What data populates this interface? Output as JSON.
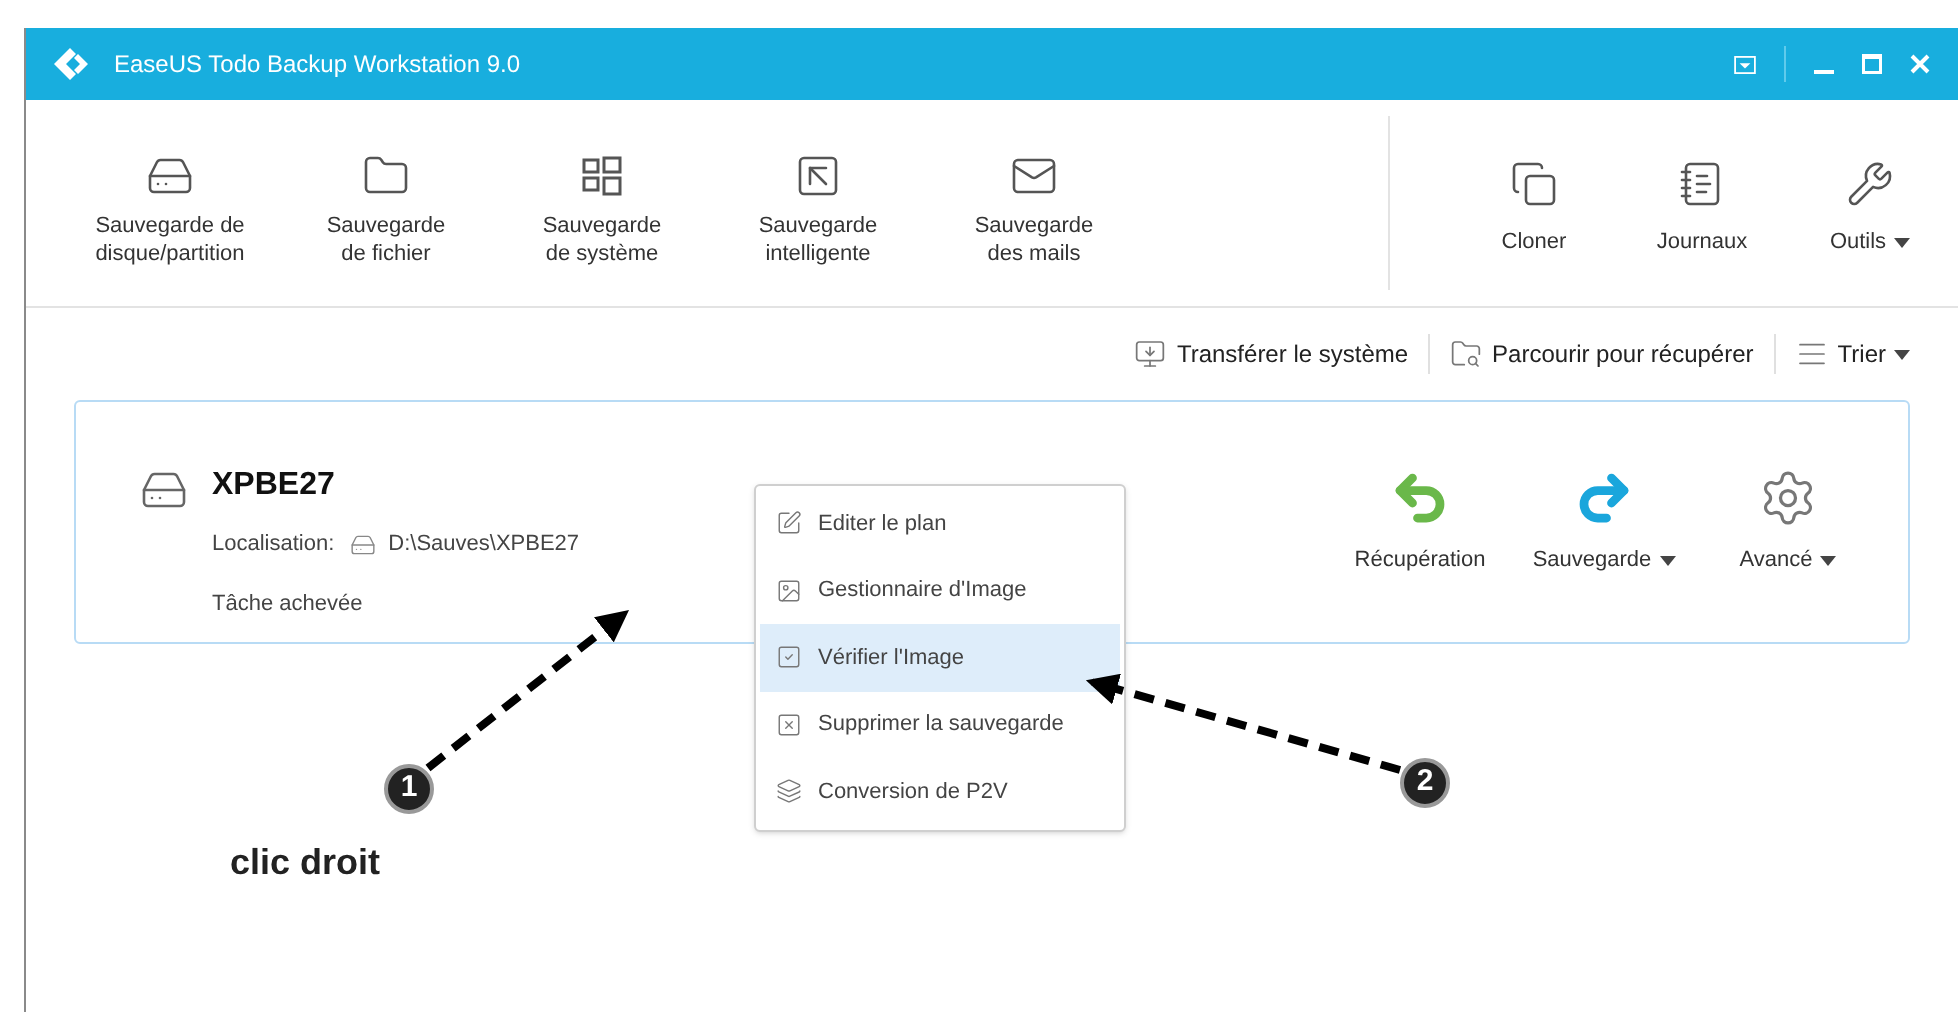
{
  "window": {
    "title": "EaseUS Todo Backup Workstation 9.0"
  },
  "toolbar": {
    "left": [
      {
        "kind": "disk",
        "label": "Sauvegarde de\ndisque/partition"
      },
      {
        "kind": "folder",
        "label": "Sauvegarde\nde fichier"
      },
      {
        "kind": "windows",
        "label": "Sauvegarde\nde système"
      },
      {
        "kind": "smart",
        "label": "Sauvegarde\nintelligente"
      },
      {
        "kind": "mail",
        "label": "Sauvegarde\ndes mails"
      }
    ],
    "right": [
      {
        "kind": "clone",
        "label": "Cloner",
        "dropdown": false
      },
      {
        "kind": "log",
        "label": "Journaux",
        "dropdown": false
      },
      {
        "kind": "wrench",
        "label": "Outils",
        "dropdown": true
      }
    ]
  },
  "actions": [
    {
      "kind": "transfer",
      "label": "Transférer le système",
      "dropdown": false
    },
    {
      "kind": "browse",
      "label": "Parcourir pour récupérer",
      "dropdown": false
    },
    {
      "kind": "sort",
      "label": "Trier",
      "dropdown": true
    }
  ],
  "backup": {
    "name": "XPBE27",
    "location_label": "Localisation:",
    "location": "D:\\Sauves\\XPBE27",
    "status": "Tâche achevée",
    "buttons": [
      {
        "kind": "recover",
        "label": "Récupération",
        "dropdown": false
      },
      {
        "kind": "backup",
        "label": "Sauvegarde",
        "dropdown": true
      },
      {
        "kind": "gear",
        "label": "Avancé",
        "dropdown": true
      }
    ]
  },
  "context_menu": [
    {
      "kind": "edit",
      "label": "Editer le plan",
      "selected": false
    },
    {
      "kind": "image",
      "label": "Gestionnaire d'Image",
      "selected": false
    },
    {
      "kind": "check",
      "label": "Vérifier l'Image",
      "selected": true
    },
    {
      "kind": "delete",
      "label": "Supprimer la sauvegarde",
      "selected": false
    },
    {
      "kind": "p2v",
      "label": "Conversion de P2V",
      "selected": false
    }
  ],
  "annotations": {
    "markers": [
      "1",
      "2"
    ],
    "caption": "clic droit"
  }
}
